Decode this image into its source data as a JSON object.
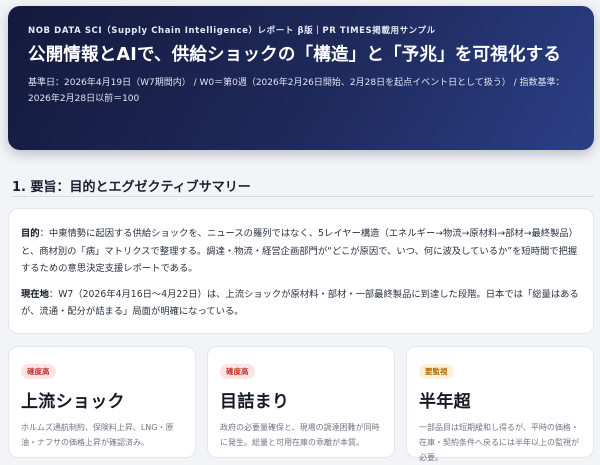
{
  "hero": {
    "eyebrow": "NOB DATA SCI（Supply Chain Intelligence）レポート β版｜PR TIMES掲載用サンプル",
    "title": "公開情報とAIで、供給ショックの「構造」と「予兆」を可視化する",
    "meta": "基準日：2026年4月19日（W7期間内） / W0＝第0週（2026年2月26日開始、2月28日を起点イベント日として扱う） / 指数基準：2026年2月28日以前＝100"
  },
  "section": {
    "title": "1. 要旨：目的とエグゼクティブサマリー"
  },
  "summary": {
    "purpose_label": "目的",
    "purpose_text": "：中東情勢に起因する供給ショックを、ニュースの羅列ではなく、5レイヤー構造（エネルギー→物流→原材料→部材→最終製品）と、商材別の「病」マトリクスで整理する。調達・物流・経営企画部門が“どこが原因で、いつ、何に波及しているか”を短時間で把握するための意思決定支援レポートである。",
    "status_label": "現在地",
    "status_text": "：W7（2026年4月16日〜4月22日）は、上流ショックが原材料・部材・一部最終製品に到達した段階。日本では「総量はあるが、流通・配分が詰まる」局面が明確になっている。"
  },
  "cards": [
    {
      "badge": "確度高",
      "head": "上流ショック",
      "desc": "ホルムズ通航制約、保険料上昇、LNG・原油・ナフサの価格上昇が確認済み。"
    },
    {
      "badge": "確度高",
      "head": "目詰まり",
      "desc": "政府の必要量確保と、現場の調達困難が同時に発生。総量と可用在庫の乖離が本質。"
    },
    {
      "badge": "要監視",
      "head": "半年超",
      "desc": "一部品目は短期緩和し得るが、平時の価格・在庫・契約条件へ戻るには半年以上の監視が必要。"
    }
  ],
  "colors": {
    "hero_gradient_start": "#141a3c",
    "hero_gradient_end": "#2b3f86",
    "badge_high_bg": "#fde3e3",
    "badge_high_text": "#c2362f",
    "badge_watch_bg": "#fff0d6",
    "badge_watch_text": "#b06a00"
  }
}
